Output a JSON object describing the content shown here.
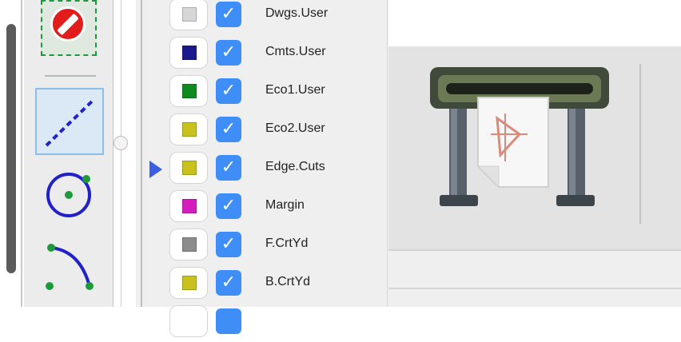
{
  "layers": [
    {
      "name": "Dwgs.User",
      "color": "#d6d6d6",
      "checked": true
    },
    {
      "name": "Cmts.User",
      "color": "#1a1a8c",
      "checked": true
    },
    {
      "name": "Eco1.User",
      "color": "#0f8a1f",
      "checked": true
    },
    {
      "name": "Eco2.User",
      "color": "#c9c21c",
      "checked": true
    },
    {
      "name": "Edge.Cuts",
      "color": "#c9c21c",
      "checked": true,
      "active": true
    },
    {
      "name": "Margin",
      "color": "#d61bbf",
      "checked": true
    },
    {
      "name": "F.CrtYd",
      "color": "#8c8c8c",
      "checked": true
    },
    {
      "name": "B.CrtYd",
      "color": "#c9c21c",
      "checked": true
    }
  ],
  "check_glyph": "✓",
  "tools": [
    "no-entry-icon",
    "line-icon",
    "circle-icon",
    "arc-icon"
  ],
  "toolbar": {
    "icon": "plotter-icon"
  }
}
